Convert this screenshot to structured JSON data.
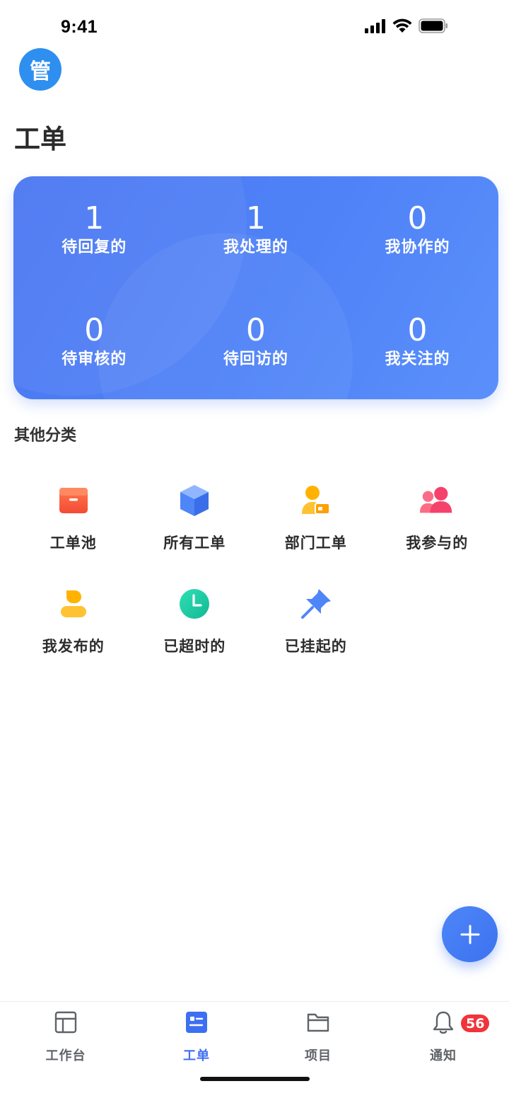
{
  "status_bar": {
    "time": "9:41"
  },
  "avatar": {
    "text": "管",
    "color": "#2e8ff0"
  },
  "page": {
    "title": "工单"
  },
  "stats": [
    {
      "value": "1",
      "label": "待回复的"
    },
    {
      "value": "1",
      "label": "我处理的"
    },
    {
      "value": "0",
      "label": "我协作的"
    },
    {
      "value": "0",
      "label": "待审核的"
    },
    {
      "value": "0",
      "label": "待回访的"
    },
    {
      "value": "0",
      "label": "我关注的"
    }
  ],
  "section": {
    "title": "其他分类"
  },
  "categories": [
    {
      "label": "工单池",
      "icon": "box-icon",
      "color": "#fa5a3c"
    },
    {
      "label": "所有工单",
      "icon": "cube-icon",
      "color": "#4e86f8"
    },
    {
      "label": "部门工单",
      "icon": "user-card-icon",
      "color": "#ffb300"
    },
    {
      "label": "我参与的",
      "icon": "group-icon",
      "color": "#f5426c"
    },
    {
      "label": "我发布的",
      "icon": "person-icon",
      "color": "#ffb300"
    },
    {
      "label": "已超时的",
      "icon": "clock-icon",
      "color": "#1ec8a5"
    },
    {
      "label": "已挂起的",
      "icon": "pin-icon",
      "color": "#4e86f8"
    }
  ],
  "fab": {
    "icon": "plus-icon"
  },
  "tabs": [
    {
      "label": "工作台",
      "icon": "dashboard-icon",
      "active": false
    },
    {
      "label": "工单",
      "icon": "ticket-icon",
      "active": true
    },
    {
      "label": "项目",
      "icon": "folder-icon",
      "active": false
    },
    {
      "label": "通知",
      "icon": "bell-icon",
      "active": false,
      "badge": "56"
    }
  ],
  "colors": {
    "accent": "#3d6ff2",
    "badge": "#f0343a"
  }
}
